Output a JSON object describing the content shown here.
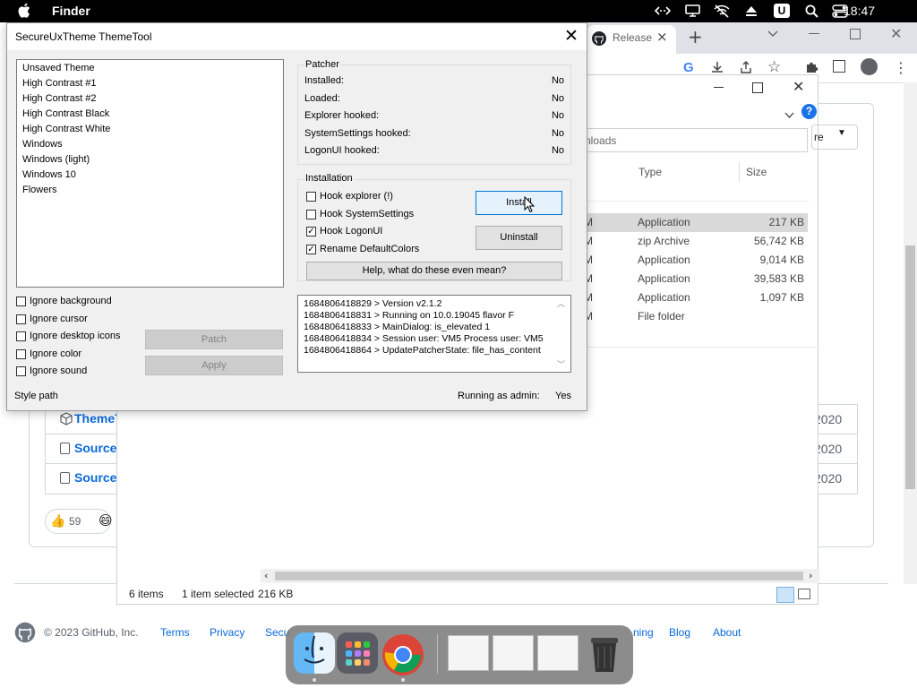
{
  "menubar": {
    "app_name": "Finder",
    "clock": "18:47",
    "icons": [
      "apple-icon",
      "code-icon",
      "display-icon",
      "no-wifi-icon",
      "eject-icon",
      "u-badge-icon",
      "search-icon",
      "control-center-icon"
    ]
  },
  "chrome": {
    "tab_title": "Release",
    "tab_close": "×",
    "new_tab": "+"
  },
  "explorer": {
    "search_text": "nloads",
    "columns": {
      "type": "Type",
      "size": "Size"
    },
    "rows": [
      {
        "m": "M",
        "type": "Application",
        "size": "217 KB"
      },
      {
        "m": "M",
        "type": "zip Archive",
        "size": "56,742 KB"
      },
      {
        "m": "M",
        "type": "Application",
        "size": "9,014 KB"
      },
      {
        "m": "M",
        "type": "Application",
        "size": "39,583 KB"
      },
      {
        "m": "M",
        "type": "Application",
        "size": "1,097 KB"
      },
      {
        "m": "M",
        "type": "File folder",
        "size": ""
      }
    ],
    "status": {
      "items": "6 items",
      "selected": "1 item selected",
      "size": "216 KB"
    },
    "re_button": "re"
  },
  "github": {
    "assets": [
      {
        "name": "ThemeT",
        "date": "2020"
      },
      {
        "name": "Source",
        "date": "2020"
      },
      {
        "name": "Source",
        "date": "2020"
      }
    ],
    "reaction_count": "59",
    "footer": {
      "copyright": "© 2023 GitHub, Inc.",
      "links": [
        "Terms",
        "Privacy",
        "Secu",
        "ning",
        "Blog",
        "About"
      ]
    }
  },
  "tool": {
    "title": "SecureUxTheme ThemeTool",
    "themes": [
      "Unsaved Theme",
      "High Contrast #1",
      "High Contrast #2",
      "High Contrast Black",
      "High Contrast White",
      "Windows",
      "Windows (light)",
      "Windows 10",
      "Flowers"
    ],
    "ignore_options": [
      {
        "label": "Ignore background",
        "checked": false
      },
      {
        "label": "Ignore cursor",
        "checked": false
      },
      {
        "label": "Ignore desktop icons",
        "checked": false
      },
      {
        "label": "Ignore color",
        "checked": false
      },
      {
        "label": "Ignore sound",
        "checked": false
      }
    ],
    "patch_button": "Patch",
    "apply_button": "Apply",
    "style_path_label": "Style path",
    "running_as_admin_label": "Running as admin:",
    "running_as_admin_value": "Yes",
    "patcher": {
      "heading": "Patcher",
      "rows": [
        {
          "label": "Installed:",
          "value": "No"
        },
        {
          "label": "Loaded:",
          "value": "No"
        },
        {
          "label": "Explorer hooked:",
          "value": "No"
        },
        {
          "label": "SystemSettings hooked:",
          "value": "No"
        },
        {
          "label": "LogonUI hooked:",
          "value": "No"
        }
      ]
    },
    "installation": {
      "heading": "Installation",
      "options": [
        {
          "label": "Hook explorer (!)",
          "checked": false
        },
        {
          "label": "Hook SystemSettings",
          "checked": false
        },
        {
          "label": "Hook LogonUI",
          "checked": true
        },
        {
          "label": "Rename DefaultColors",
          "checked": true
        }
      ],
      "install_button": "Install",
      "uninstall_button": "Uninstall",
      "help_button": "Help, what do these even mean?"
    },
    "log": [
      "1684806418829 > Version v2.1.2",
      "1684806418831 > Running on 10.0.19045 flavor F",
      "1684806418833 > MainDialog: is_elevated 1",
      "1684806418834 > Session user: VM5 Process user: VM5",
      "1684806418864 > UpdatePatcherState: file_has_content"
    ]
  },
  "colors": {
    "accent": "#0078d7",
    "github_link": "#0969da",
    "menubar": "#000000"
  }
}
